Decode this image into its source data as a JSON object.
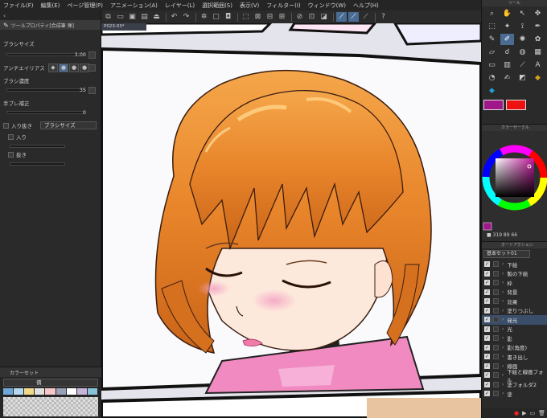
{
  "menu": [
    "ファイル(F)",
    "編集(E)",
    "ページ管理(P)",
    "アニメーション(A)",
    "レイヤー(L)",
    "選択範囲(S)",
    "表示(V)",
    "フィルター(I)",
    "ウィンドウ(W)",
    "ヘルプ(H)"
  ],
  "canvas_tab": "P023-03*",
  "left_panel": {
    "title": "ツールプロパティ[合成筆 弾]",
    "brush_size_label": "ブラシサイズ",
    "brush_size_value": "3.00",
    "antialias_label": "アンチエイリアス",
    "brush_density_label": "ブラシ濃度",
    "brush_density_value": "35",
    "stabilization_label": "手ブレ補正",
    "stabilization_value": "0",
    "taper_label": "入り抜き",
    "taper_select": "ブラシサイズ",
    "taper_in_label": "入り",
    "taper_out_label": "抜き",
    "colorset_title": "カラーセット",
    "colorset_select": "債"
  },
  "right_panel": {
    "tool_header": "ツール",
    "main_color": "#a0178a",
    "sub_color": "#ee1111",
    "colorwheel_title": "カラーサークル",
    "color_values": "■ 319  89  66",
    "autoaction_title": "オートアクション",
    "autoaction_set": "基本セット01",
    "autoaction_items": [
      {
        "label": "下絵",
        "selected": false
      },
      {
        "label": "製の下絵",
        "selected": false
      },
      {
        "label": "枠",
        "selected": false
      },
      {
        "label": "背景",
        "selected": false
      },
      {
        "label": "効果",
        "selected": false
      },
      {
        "label": "塗りつぶし",
        "selected": false
      },
      {
        "label": "発光",
        "selected": true
      },
      {
        "label": "光",
        "selected": false
      },
      {
        "label": "影",
        "selected": false
      },
      {
        "label": "影(角度)",
        "selected": false
      },
      {
        "label": "書き出し",
        "selected": false
      },
      {
        "label": "線画",
        "selected": false
      },
      {
        "label": "下絵と線画フォル",
        "selected": false
      },
      {
        "label": "塗フォルダ2",
        "selected": false
      },
      {
        "label": "塗",
        "selected": false
      }
    ]
  },
  "icons": {
    "brush": "brush-icon",
    "pen": "pen-icon",
    "eraser": "eraser-icon",
    "fill": "fill-icon",
    "lasso": "lasso-icon",
    "text": "text-icon",
    "hand": "hand-icon",
    "undo": "undo-icon",
    "redo": "redo-icon"
  }
}
